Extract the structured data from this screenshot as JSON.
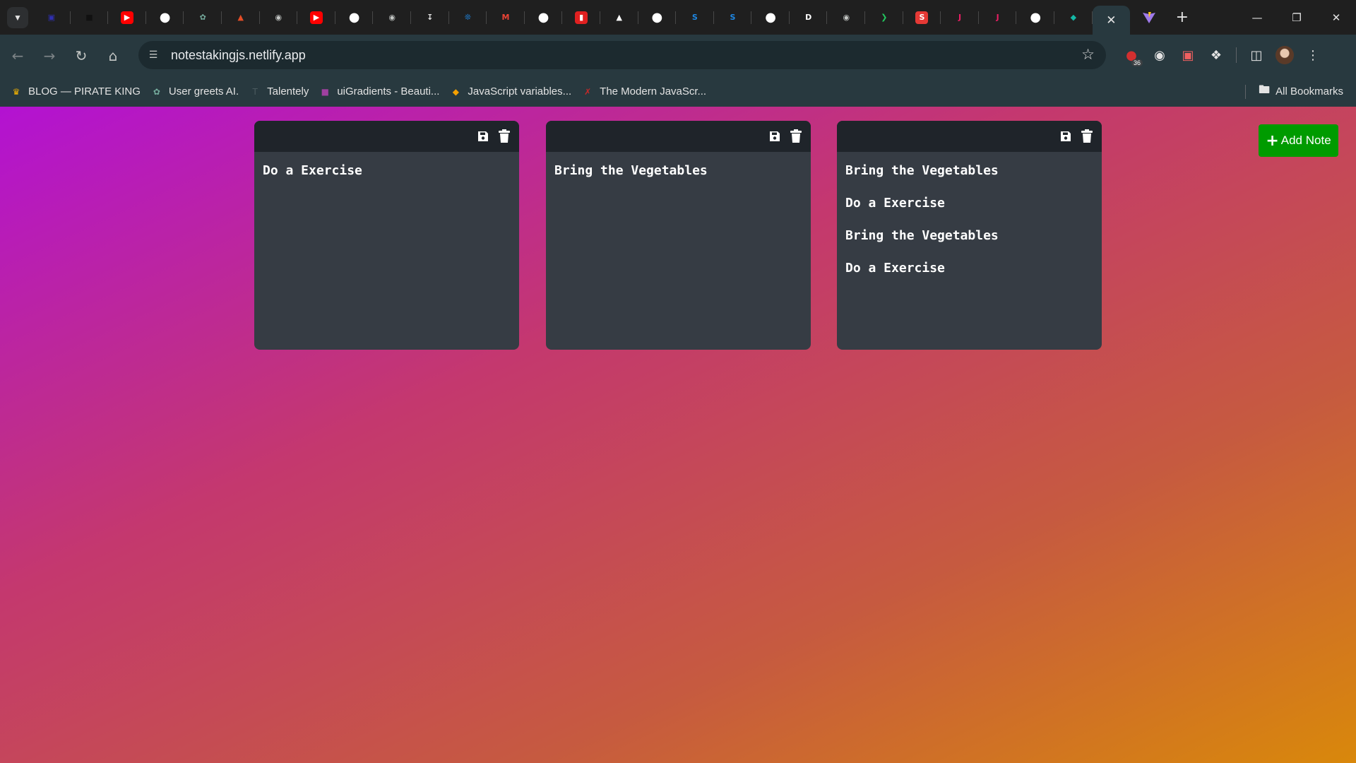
{
  "browser": {
    "tabs": [
      {
        "icon": "dashboard-favicon",
        "color": "#2f2fb0"
      },
      {
        "icon": "square-favicon",
        "color": "#111111"
      },
      {
        "icon": "youtube-favicon",
        "color": "#ff0000"
      },
      {
        "icon": "github-favicon",
        "color": "#ffffff"
      },
      {
        "icon": "openai-favicon",
        "color": "#74aa9c"
      },
      {
        "icon": "html5-favicon",
        "color": "#e44d26"
      },
      {
        "icon": "globe-favicon",
        "color": "#c4c7c5"
      },
      {
        "icon": "youtube-favicon",
        "color": "#ff0000"
      },
      {
        "icon": "github-favicon",
        "color": "#ffffff"
      },
      {
        "icon": "globe-favicon",
        "color": "#c4c7c5"
      },
      {
        "icon": "download-favicon",
        "color": "#e3e3e3"
      },
      {
        "icon": "brand-favicon",
        "color": "#1e88e5"
      },
      {
        "icon": "gmail-favicon",
        "color": "#ea4335"
      },
      {
        "icon": "github-favicon",
        "color": "#ffffff"
      },
      {
        "icon": "red-square-favicon",
        "color": "#e02020"
      },
      {
        "icon": "triangle-favicon",
        "color": "#ffffff"
      },
      {
        "icon": "github-favicon",
        "color": "#ffffff"
      },
      {
        "icon": "s-favicon",
        "color": "#1e88e5"
      },
      {
        "icon": "s-favicon",
        "color": "#1e88e5"
      },
      {
        "icon": "github-favicon",
        "color": "#ffffff"
      },
      {
        "icon": "d-favicon",
        "color": "#ffffff"
      },
      {
        "icon": "globe-favicon",
        "color": "#c4c7c5"
      },
      {
        "icon": "terminal-favicon",
        "color": "#22c55e"
      },
      {
        "icon": "s-red-favicon",
        "color": "#e53935"
      },
      {
        "icon": "j-favicon",
        "color": "#e91e63"
      },
      {
        "icon": "j-favicon",
        "color": "#e91e63"
      },
      {
        "icon": "github-favicon",
        "color": "#ffffff"
      },
      {
        "icon": "diamond-favicon",
        "color": "#14b8a6"
      }
    ],
    "address_bar": {
      "url": "notestakingjs.netlify.app"
    },
    "extension_badge": "36",
    "bookmarks": [
      {
        "label": "BLOG — PIRATE KING",
        "icon": "crown-icon",
        "color": "#f5b400"
      },
      {
        "label": "User greets AI.",
        "icon": "openai-icon",
        "color": "#74aa9c"
      },
      {
        "label": "Talentely",
        "icon": "t-icon",
        "color": "#4a5a5f"
      },
      {
        "label": "uiGradients - Beauti...",
        "icon": "gradient-icon",
        "color": "#a040a0"
      },
      {
        "label": "JavaScript variables...",
        "icon": "diamond-icon",
        "color": "#f5a000"
      },
      {
        "label": "The Modern JavaScr...",
        "icon": "x-icon",
        "color": "#c62828"
      }
    ],
    "all_bookmarks": "All Bookmarks"
  },
  "app": {
    "add_note_label": "Add Note",
    "colors": {
      "add_button": "#009b00",
      "note_body": "#363c44",
      "note_header": "#1f242a"
    },
    "notes": [
      {
        "lines": [
          "Do a Exercise"
        ]
      },
      {
        "lines": [
          "Bring the Vegetables"
        ]
      },
      {
        "lines": [
          "Bring the Vegetables",
          "Do a Exercise",
          "Bring the Vegetables",
          "Do a Exercise"
        ]
      }
    ]
  }
}
